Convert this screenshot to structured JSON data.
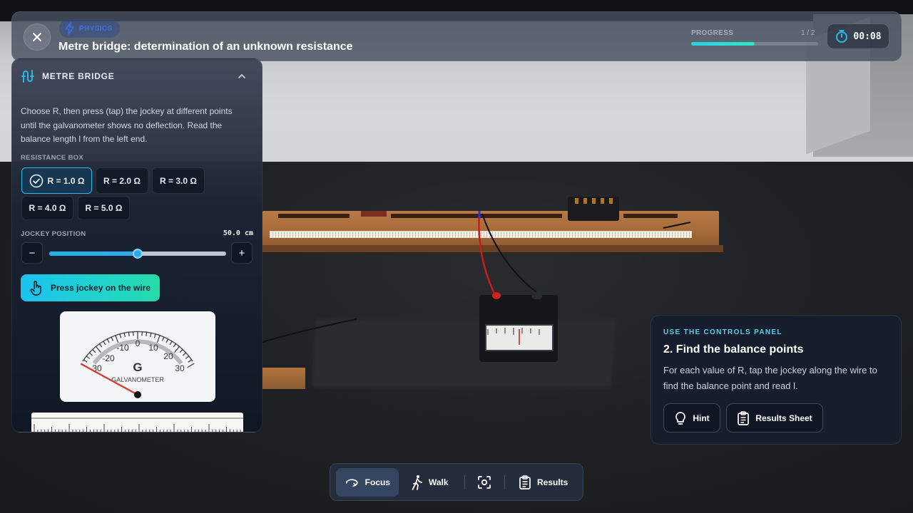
{
  "header": {
    "subject": "PHYSICS",
    "title": "Metre bridge: determination of an unknown resistance",
    "progress_label": "PROGRESS",
    "progress_count": "1 / 2",
    "progress_fraction": 0.5,
    "timer": "00:08"
  },
  "panel": {
    "title": "METRE BRIDGE",
    "description": "Choose R, then press (tap) the jockey at different points until the galvanometer shows no deflection. Read the balance length l from the left end.",
    "resistance_label": "RESISTANCE BOX",
    "resistances": [
      {
        "label": "R = 1.0 Ω",
        "selected": true
      },
      {
        "label": "R = 2.0 Ω",
        "selected": false
      },
      {
        "label": "R = 3.0 Ω",
        "selected": false
      },
      {
        "label": "R = 4.0 Ω",
        "selected": false
      },
      {
        "label": "R = 5.0 Ω",
        "selected": false
      }
    ],
    "jockey_label": "JOCKEY POSITION",
    "jockey_value": "50.0 cm",
    "jockey_fraction": 0.5,
    "minus": "−",
    "plus": "+",
    "press_button": "Press jockey on the wire",
    "galvanometer": {
      "ticks": [
        "-20",
        "-10",
        "0",
        "10",
        "20"
      ],
      "ends": [
        "30",
        "30"
      ],
      "letter": "G",
      "caption": "GALVANOMETER"
    }
  },
  "info": {
    "eyebrow": "USE THE CONTROLS PANEL",
    "title": "2. Find the balance points",
    "body": "For each value of R, tap the jockey along the wire to find the balance point and read l.",
    "hint_button": "Hint",
    "results_sheet_button": "Results Sheet"
  },
  "toolbar": {
    "focus": "Focus",
    "walk": "Walk",
    "results": "Results"
  },
  "colors": {
    "accent": "#2db6e6",
    "press_gradient_start": "#1bc3ee",
    "press_gradient_end": "#26dba6",
    "eyebrow": "#5ad0ea"
  }
}
